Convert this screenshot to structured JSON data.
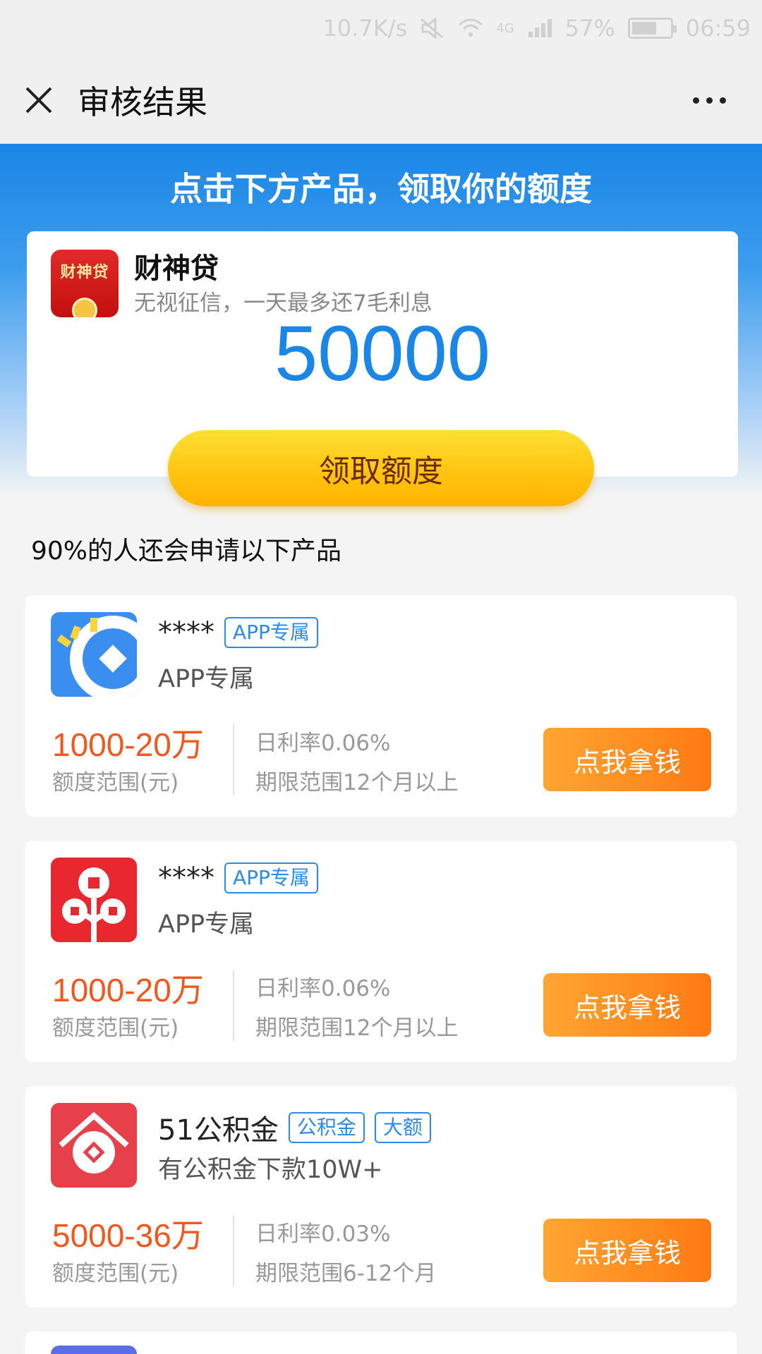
{
  "status_bar": {
    "speed": "10.7K/s",
    "network": "4G",
    "battery": "57%",
    "time": "06:59"
  },
  "nav": {
    "title": "审核结果"
  },
  "hero": {
    "title": "点击下方产品，领取你的额度",
    "logo_text": "财神贷",
    "product_name": "财神贷",
    "description": "无视征信，一天最多还7毛利息",
    "amount": "50000",
    "button_label": "领取额度"
  },
  "section_title": "90%的人还会申请以下产品",
  "products": [
    {
      "name": "****",
      "tags": [
        "APP专属"
      ],
      "subtitle": "APP专属",
      "range": "1000-20万",
      "range_label": "额度范围(元)",
      "rate": "日利率0.06%",
      "term": "期限范围12个月以上",
      "button_label": "点我拿钱",
      "logo_color": "#3a8ef0"
    },
    {
      "name": "****",
      "tags": [
        "APP专属"
      ],
      "subtitle": "APP专属",
      "range": "1000-20万",
      "range_label": "额度范围(元)",
      "rate": "日利率0.06%",
      "term": "期限范围12个月以上",
      "button_label": "点我拿钱",
      "logo_color": "#e8282e"
    },
    {
      "name": "51公积金",
      "tags": [
        "公积金",
        "大额"
      ],
      "subtitle": "有公积金下款10W+",
      "range": "5000-36万",
      "range_label": "额度范围(元)",
      "rate": "日利率0.03%",
      "term": "期限范围6-12个月",
      "button_label": "点我拿钱",
      "logo_color": "#e8404a"
    }
  ],
  "colors": {
    "accent_blue": "#1a86e6",
    "range_orange": "#f2571d",
    "button_orange": "#ff7a12",
    "claim_yellow": "#ffc20e"
  }
}
